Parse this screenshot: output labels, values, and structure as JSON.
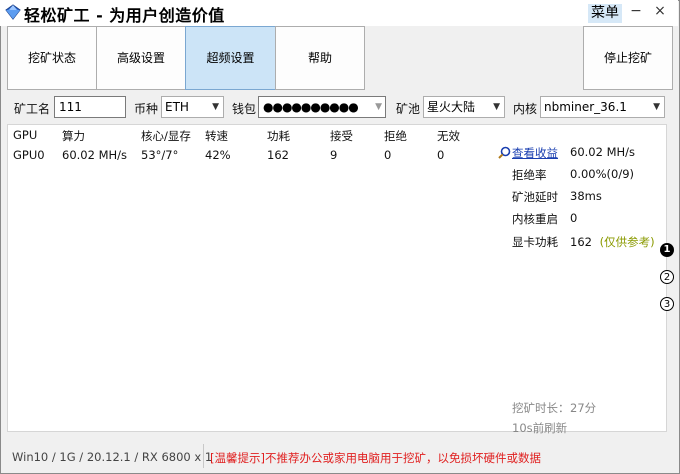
{
  "window": {
    "title": "轻松矿工 - 为用户创造价值",
    "menu_label": "菜单",
    "minimize_glyph": "−",
    "close_glyph": "×"
  },
  "tabs": [
    {
      "label": "挖矿状态",
      "active": false
    },
    {
      "label": "高级设置",
      "active": false
    },
    {
      "label": "超频设置",
      "active": true
    },
    {
      "label": "帮助",
      "active": false
    }
  ],
  "stop_button": "停止挖矿",
  "settings": {
    "worker_label": "矿工名",
    "worker_value": "111",
    "coin_label": "币种",
    "coin_value": "ETH",
    "wallet_label": "钱包",
    "wallet_value": "●●●●●●●●●●",
    "pool_label": "矿池",
    "pool_value": "星火大陆",
    "kernel_label": "内核",
    "kernel_value": "nbminer_36.1"
  },
  "gpu_table": {
    "headers": [
      "GPU",
      "算力",
      "核心/显存",
      "转速",
      "功耗",
      "接受",
      "拒绝",
      "无效"
    ],
    "rows": [
      [
        "GPU0",
        "60.02 MH/s",
        "53°/7°",
        "42%",
        "162",
        "9",
        "0",
        "0"
      ]
    ]
  },
  "stats": {
    "view_earnings": "查看收益",
    "hashrate": "60.02 MH/s",
    "reject_rate_label": "拒绝率",
    "reject_rate": "0.00%(0/9)",
    "pool_latency_label": "矿池延时",
    "pool_latency": "38ms",
    "kernel_restart_label": "内核重启",
    "kernel_restart": "0",
    "gpu_power_label": "显卡功耗",
    "gpu_power": "162",
    "gpu_power_note": "(仅供参考)",
    "mining_time_label": "挖矿时长：",
    "mining_time": "27分",
    "refresh_text": "10s前刷新"
  },
  "pagination": [
    "1",
    "2",
    "3"
  ],
  "status": {
    "system_info": "Win10  / 1G / 20.12.1 / RX 6800 x 1",
    "warning": "[温馨提示]不推荐办公或家用电脑用于挖矿，以免损坏硬件或数据"
  },
  "colors": {
    "active_tab": "#cce4f7",
    "warning_text": "#e02020",
    "link": "#1a3fb0",
    "note": "#8a9a00"
  }
}
